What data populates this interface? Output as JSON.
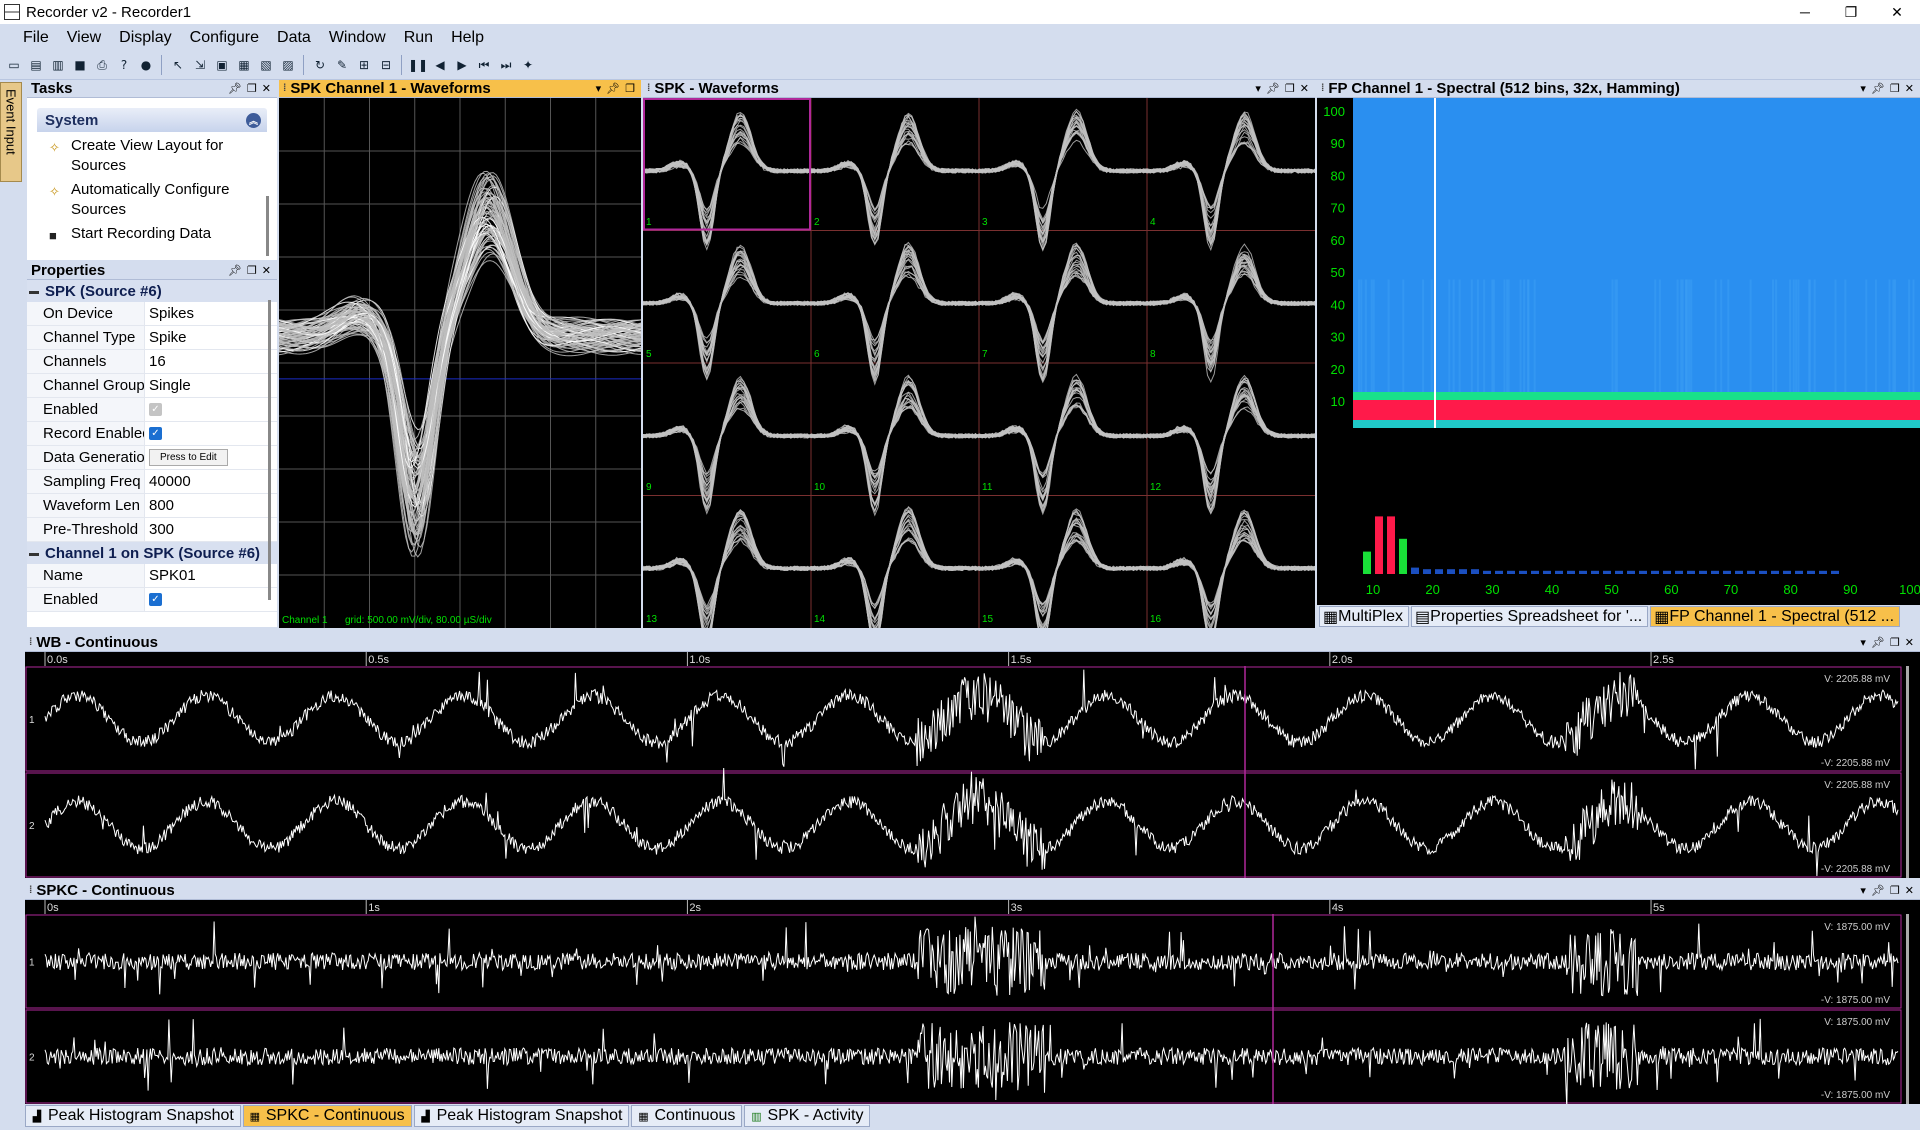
{
  "window": {
    "title": "Recorder v2 - Recorder1",
    "controls": [
      "─",
      "❐",
      "✕"
    ]
  },
  "menu": [
    "File",
    "View",
    "Display",
    "Configure",
    "Data",
    "Window",
    "Run",
    "Help"
  ],
  "toolbar": {
    "icons": [
      "new-icon",
      "open-icon",
      "open-folder-icon",
      "save-icon",
      "print-icon",
      "help-icon",
      "about-icon",
      "pointer-icon",
      "connect-icon",
      "source-icon",
      "device-icon",
      "layout-icon",
      "link-icon",
      "cursor-icon",
      "mode-icon",
      "mode-alt-icon",
      "pause-icon",
      "back-icon",
      "forward-icon",
      "step-back-icon",
      "step-forward-icon",
      "spark-icon"
    ]
  },
  "side_tab": {
    "label": "Event Input"
  },
  "tasks": {
    "title": "Tasks",
    "section": "System",
    "items": [
      {
        "label": "Create View Layout for Sources",
        "icon": "wand-icon"
      },
      {
        "label": "Automatically Configure Sources",
        "icon": "wand-icon"
      },
      {
        "label": "Start Recording Data",
        "icon": "record-icon"
      }
    ]
  },
  "properties": {
    "title": "Properties",
    "category1": "SPK (Source #6)",
    "rows1": [
      {
        "name": "On Device",
        "value": "Spikes"
      },
      {
        "name": "Channel Type",
        "value": "Spike"
      },
      {
        "name": "Channels",
        "value": "16"
      },
      {
        "name": "Channel Group",
        "value": "Single"
      },
      {
        "name": "Enabled",
        "value": "",
        "check": "disabled"
      },
      {
        "name": "Record Enabled",
        "value": "",
        "check": "checked"
      },
      {
        "name": "Data Generation",
        "value": "Press to Edit",
        "button": true
      },
      {
        "name": "Sampling Freq",
        "value": "40000"
      },
      {
        "name": "Waveform Len",
        "value": "800"
      },
      {
        "name": "Pre-Threshold",
        "value": "300"
      }
    ],
    "category2": "Channel 1 on SPK (Source #6)",
    "rows2": [
      {
        "name": "Name",
        "value": "SPK01"
      },
      {
        "name": "Enabled",
        "value": "",
        "check": "checked"
      }
    ]
  },
  "waveform_panel": {
    "title": "SPK Channel 1 - Waveforms",
    "channel_label": "Channel 1",
    "grid_label": "grid: 500.00 mV/div, 80.00 µS/div"
  },
  "waveforms_grid": {
    "title": "SPK - Waveforms",
    "cells": [
      "1",
      "2",
      "3",
      "4",
      "5",
      "6",
      "7",
      "8",
      "9",
      "10",
      "11",
      "12",
      "13",
      "14",
      "15",
      "16"
    ]
  },
  "spectral": {
    "title": "FP Channel 1 - Spectral (512 bins, 32x, Hamming)",
    "y_ticks": [
      "100",
      "90",
      "80",
      "70",
      "60",
      "50",
      "40",
      "30",
      "20",
      "10"
    ],
    "x_ticks": [
      "10",
      "20",
      "30",
      "40",
      "50",
      "60",
      "70",
      "80",
      "90",
      "100"
    ],
    "tabs": [
      "MultiPlex",
      "Properties Spreadsheet for '...",
      "FP Channel 1 - Spectral (512 ..."
    ]
  },
  "wb": {
    "title": "WB - Continuous",
    "time_ticks": [
      "0.0s",
      "0.5s",
      "1.0s",
      "1.5s",
      "2.0s",
      "2.5s"
    ],
    "channels": [
      "1",
      "2"
    ],
    "vmax": "V: 2205.88 mV",
    "vmin": "-V: 2205.88 mV"
  },
  "spkc": {
    "title": "SPKC - Continuous",
    "time_ticks": [
      "0s",
      "1s",
      "2s",
      "3s",
      "4s",
      "5s"
    ],
    "channels": [
      "1",
      "2"
    ],
    "vmax": "V: 1875.00 mV",
    "vmin": "-V: 1875.00 mV"
  },
  "bottom_tabs": [
    "Peak Histogram Snapshot",
    "SPKC - Continuous",
    "Peak Histogram Snapshot",
    "Continuous",
    "SPK - Activity"
  ],
  "colors": {
    "accent": "#f7c04a",
    "plot_bg": "#000000",
    "label_green": "#00e000",
    "cursor": "#b0289a",
    "spectrum_blue": "#2a8ff0",
    "spectrum_red": "#ff1a4a"
  }
}
